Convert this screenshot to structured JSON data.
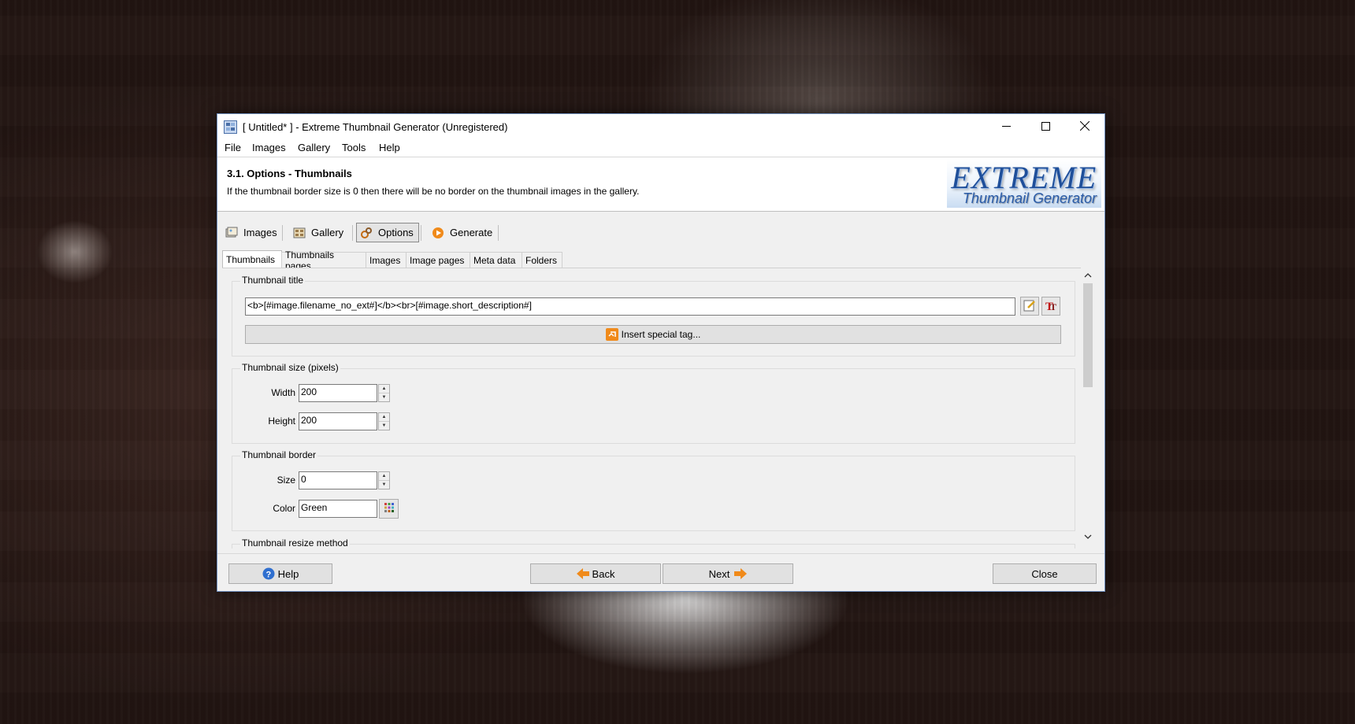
{
  "window": {
    "title": "[ Untitled* ] - Extreme Thumbnail Generator (Unregistered)",
    "controls": {
      "minimize": "minimize-icon",
      "maximize": "maximize-icon",
      "close": "close-icon"
    }
  },
  "menu": [
    "File",
    "Images",
    "Gallery",
    "Tools",
    "Help"
  ],
  "header": {
    "title": "3.1. Options - Thumbnails",
    "description": "If the thumbnail border size is 0 then there will be no border on the thumbnail images in the gallery.",
    "logo_line1": "EXTREME",
    "logo_line2": "Thumbnail Generator"
  },
  "steps": [
    {
      "label": "Images",
      "icon": "images-icon"
    },
    {
      "label": "Gallery",
      "icon": "gallery-icon"
    },
    {
      "label": "Options",
      "icon": "options-icon",
      "active": true
    },
    {
      "label": "Generate",
      "icon": "generate-icon"
    }
  ],
  "tabs": [
    "Thumbnails",
    "Thumbnails pages",
    "Images",
    "Image pages",
    "Meta data",
    "Folders"
  ],
  "thumbnail_title": {
    "legend": "Thumbnail title",
    "value": "<b>[#image.filename_no_ext#]</b><br>[#image.short_description#]",
    "insert_button": "Insert special tag..."
  },
  "thumbnail_size": {
    "legend": "Thumbnail size (pixels)",
    "width_label": "Width",
    "width_value": "200",
    "height_label": "Height",
    "height_value": "200"
  },
  "thumbnail_border": {
    "legend": "Thumbnail border",
    "size_label": "Size",
    "size_value": "0",
    "color_label": "Color",
    "color_value": "Green"
  },
  "next_group_legend": "Thumbnail resize method",
  "footer": {
    "help": "Help",
    "back": "Back",
    "next": "Next",
    "close": "Close"
  },
  "colors": {
    "accent": "#ff8c00",
    "title_border": "#6f8ebc",
    "logo_blue": "#1f4f9a"
  }
}
